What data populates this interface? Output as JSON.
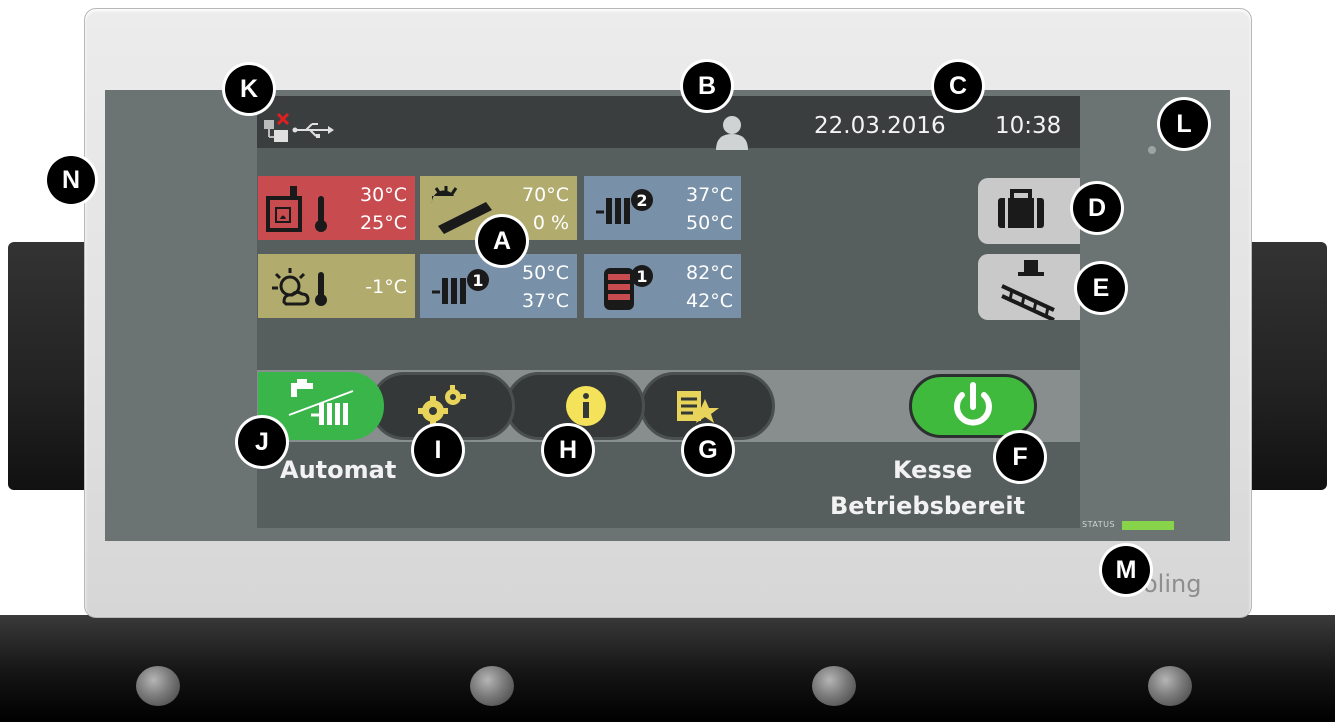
{
  "header": {
    "date": "22.03.2016",
    "time": "10:38"
  },
  "tiles": [
    {
      "id": "boiler",
      "line1": "30°C",
      "line2": "25°C",
      "color": "#c84b4f",
      "icon": "boiler-thermometer-icon"
    },
    {
      "id": "solar",
      "line1": "70°C",
      "line2": "0 %",
      "color": "#b1ab6e",
      "icon": "solar-collector-icon"
    },
    {
      "id": "heating-circuit-2",
      "line1": "37°C",
      "line2": "50°C",
      "color": "#7891a8",
      "icon": "heating-circuit-2-icon"
    },
    {
      "id": "outdoor",
      "line1": "-1°C",
      "line2": "",
      "color": "#b1ab6e",
      "icon": "weather-thermometer-icon"
    },
    {
      "id": "heating-circuit-1",
      "line1": "50°C",
      "line2": "37°C",
      "color": "#7891a8",
      "icon": "heating-circuit-1-icon"
    },
    {
      "id": "buffer-1",
      "line1": "82°C",
      "line2": "42°C",
      "color": "#7891a8",
      "icon": "buffer-tank-1-icon"
    }
  ],
  "footer": {
    "mode_label": "Automat",
    "status_line1": "Kesse",
    "status_line2": "Betriebsbereit",
    "status_word": "STATUS",
    "brand": "oling"
  },
  "callouts": {
    "a": "A",
    "b": "B",
    "c": "C",
    "d": "D",
    "e": "E",
    "f": "F",
    "g": "G",
    "h": "H",
    "i": "I",
    "j": "J",
    "k": "K",
    "l": "L",
    "m": "M",
    "n": "N"
  },
  "colors": {
    "accent_green": "#39b54a",
    "tile_red": "#c84b4f",
    "tile_yellow": "#b1ab6e",
    "tile_blue": "#7891a8",
    "status_led": "#87d44a"
  }
}
